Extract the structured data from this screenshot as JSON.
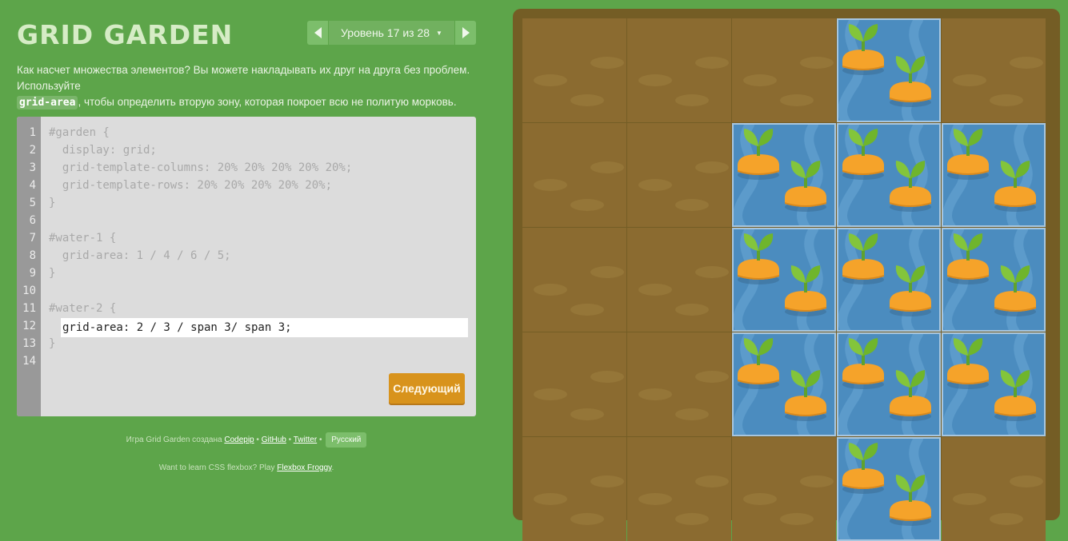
{
  "header": {
    "title": "GRID GARDEN",
    "level_label": "Уровень 17 из 28"
  },
  "instructions": {
    "part1": "Как насчет множества элементов? Вы можете накладывать их друг на друга без проблем. Используйте",
    "code": "grid-area",
    "part2": ", чтобы определить вторую зону, которая покроет всю не политую морковь."
  },
  "editor": {
    "line_numbers": [
      "1",
      "2",
      "3",
      "4",
      "5",
      "6",
      "7",
      "8",
      "9",
      "10",
      "11",
      "12",
      "13",
      "14"
    ],
    "lines": [
      "#garden {",
      "  display: grid;",
      "  grid-template-columns: 20% 20% 20% 20% 20%;",
      "  grid-template-rows: 20% 20% 20% 20% 20%;",
      "}",
      "",
      "#water-1 {",
      "  grid-area: 1 / 4 / 6 / 5;",
      "}",
      "",
      "#water-2 {",
      "",
      "}",
      ""
    ],
    "input_value": "grid-area: 2 / 3 / span 3/ span 3;",
    "next_label": "Следующий"
  },
  "footer": {
    "credit_prefix": "Игра Grid Garden создана",
    "codepip": "Codepip",
    "sep1": "•",
    "github": "GitHub",
    "sep2": "•",
    "twitter": "Twitter",
    "sep3": "•",
    "language": "Русский",
    "promo_prefix": "Want to learn CSS flexbox? Play",
    "promo_link": "Flexbox Froggy",
    "promo_suffix": "."
  },
  "garden": {
    "rows": 5,
    "cols": 5,
    "water_1": {
      "area": "1 / 4 / 6 / 5"
    },
    "water_2": {
      "area": "2 / 3 / span 3 / span 3"
    },
    "carrots": [
      {
        "row": 1,
        "col": 4
      },
      {
        "row": 2,
        "col": 3
      },
      {
        "row": 2,
        "col": 4
      },
      {
        "row": 2,
        "col": 5
      },
      {
        "row": 3,
        "col": 3
      },
      {
        "row": 3,
        "col": 4
      },
      {
        "row": 3,
        "col": 5
      },
      {
        "row": 4,
        "col": 3
      },
      {
        "row": 4,
        "col": 4
      },
      {
        "row": 4,
        "col": 5
      },
      {
        "row": 5,
        "col": 4
      }
    ]
  },
  "colors": {
    "background": "#5da54a",
    "dirt": "#8b6b30",
    "water": "#4b8cbf",
    "carrot": "#f5a32a",
    "leaf": "#83c53b",
    "next_button": "#d8931c"
  }
}
